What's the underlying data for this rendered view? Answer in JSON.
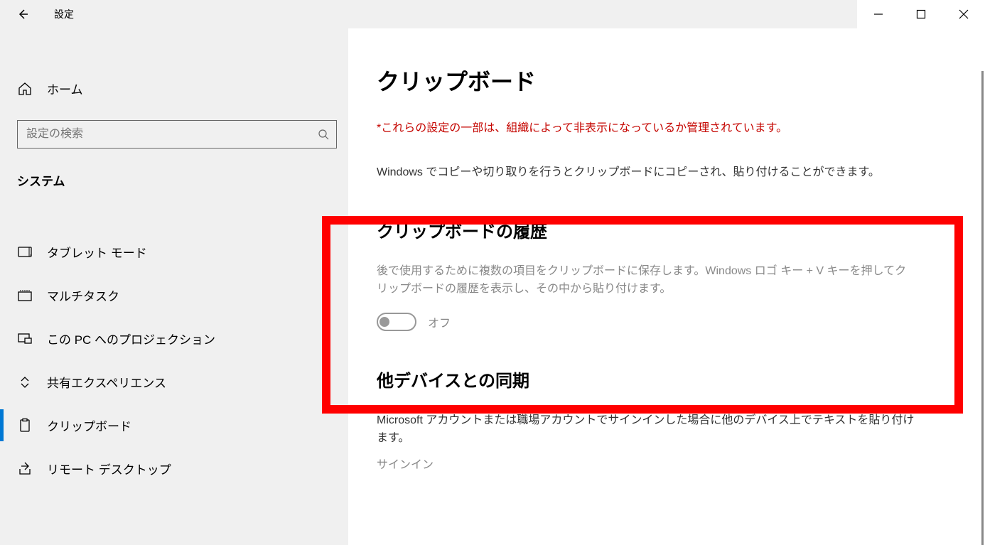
{
  "window": {
    "title": "設定"
  },
  "sidebar": {
    "home_label": "ホーム",
    "search_placeholder": "設定の検索",
    "category_label": "システム",
    "items": [
      {
        "label": "タブレット モード"
      },
      {
        "label": "マルチタスク"
      },
      {
        "label": "この PC へのプロジェクション"
      },
      {
        "label": "共有エクスペリエンス"
      },
      {
        "label": "クリップボード"
      },
      {
        "label": "リモート デスクトップ"
      }
    ]
  },
  "content": {
    "page_title": "クリップボード",
    "warning": "*これらの設定の一部は、組織によって非表示になっているか管理されています。",
    "desc": "Windows でコピーや切り取りを行うとクリップボードにコピーされ、貼り付けることができます。",
    "history": {
      "title": "クリップボードの履歴",
      "desc": "後で使用するために複数の項目をクリップボードに保存します。Windows ロゴ キー + V キーを押してクリップボードの履歴を表示し、その中から貼り付けます。",
      "toggle_label": "オフ"
    },
    "sync": {
      "title": "他デバイスとの同期",
      "desc": "Microsoft アカウントまたは職場アカウントでサインインした場合に他のデバイス上でテキストを貼り付けます。",
      "signin_label": "サインイン"
    }
  }
}
